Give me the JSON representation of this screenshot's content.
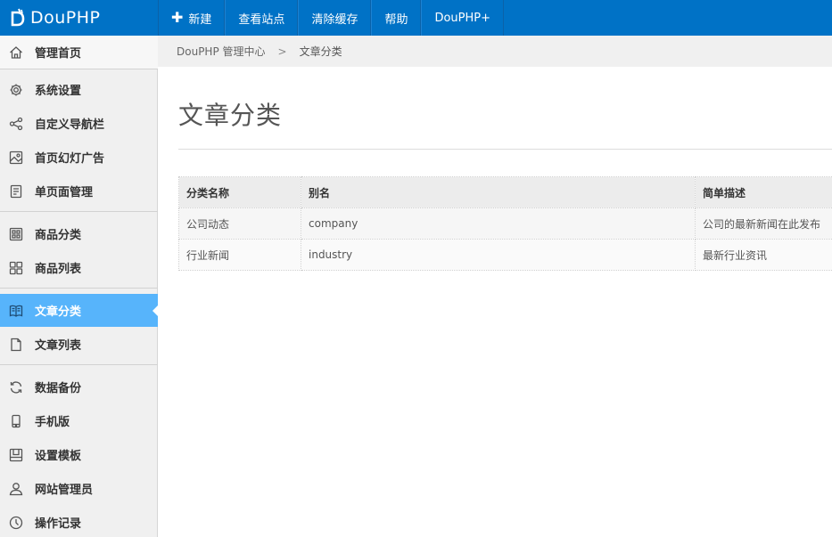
{
  "brand": {
    "logo_text": "DouPHP",
    "color": "#0072c6"
  },
  "topnav": [
    {
      "label": "新建",
      "icon": "plus-icon"
    },
    {
      "label": "查看站点"
    },
    {
      "label": "清除缓存"
    },
    {
      "label": "帮助"
    },
    {
      "label": "DouPHP+"
    }
  ],
  "sidebar": {
    "items": [
      {
        "label": "管理首页",
        "icon": "home-icon"
      },
      {
        "label": "系统设置",
        "icon": "gear-icon"
      },
      {
        "label": "自定义导航栏",
        "icon": "share-icon"
      },
      {
        "label": "首页幻灯广告",
        "icon": "image-icon"
      },
      {
        "label": "单页面管理",
        "icon": "document-lines-icon"
      },
      {
        "label": "商品分类",
        "icon": "grid-icon"
      },
      {
        "label": "商品列表",
        "icon": "apps-icon"
      },
      {
        "label": "文章分类",
        "icon": "book-icon",
        "active": true
      },
      {
        "label": "文章列表",
        "icon": "file-icon"
      },
      {
        "label": "数据备份",
        "icon": "refresh-icon"
      },
      {
        "label": "手机版",
        "icon": "mobile-icon"
      },
      {
        "label": "设置模板",
        "icon": "template-icon"
      },
      {
        "label": "网站管理员",
        "icon": "user-icon"
      },
      {
        "label": "操作记录",
        "icon": "clock-icon"
      }
    ],
    "active_color": "#57b4fb"
  },
  "breadcrumb": {
    "root": "DouPHP 管理中心",
    "separator": ">",
    "current": "文章分类"
  },
  "page": {
    "title": "文章分类"
  },
  "table": {
    "headers": [
      "分类名称",
      "别名",
      "简单描述"
    ],
    "rows": [
      [
        "公司动态",
        "company",
        "公司的最新新闻在此发布"
      ],
      [
        "行业新闻",
        "industry",
        "最新行业资讯"
      ]
    ]
  }
}
